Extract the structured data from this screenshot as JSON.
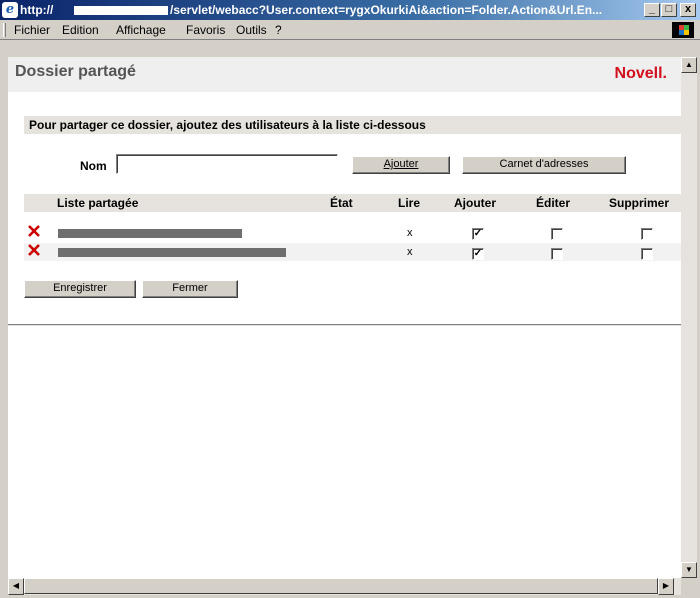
{
  "window": {
    "title_prefix": "http://",
    "title_suffix": "/servlet/webacc?User.context=rygxOkurkiAi&action=Folder.Action&Url.En...",
    "buttons": [
      "_",
      "□",
      "x"
    ]
  },
  "menu": [
    "Fichier",
    "Edition",
    "Affichage",
    "Favoris",
    "Outils",
    "?"
  ],
  "header": {
    "title": "Dossier partagé",
    "brand": "Novell."
  },
  "instructions": "Pour partager ce dossier, ajoutez des utilisateurs à la liste ci-dessous",
  "form": {
    "nom_label": "Nom",
    "nom_value": "",
    "ajouter_button": "Ajouter",
    "carnet_button": "Carnet d'adresses"
  },
  "table": {
    "headers": {
      "liste": "Liste partagée",
      "etat": "État",
      "lire": "Lire",
      "ajouter": "Ajouter",
      "editer": "Éditer",
      "supprimer": "Supprimer"
    },
    "rows": [
      {
        "lire": "x",
        "ajouter": true,
        "editer": false,
        "supprimer": false,
        "check_mark": "✓"
      },
      {
        "lire": "x",
        "ajouter": true,
        "editer": false,
        "supprimer": false,
        "check_mark": "✓"
      }
    ]
  },
  "actions": {
    "enregistrer": "Enregistrer",
    "fermer": "Fermer"
  },
  "icons": {
    "delete": "red-x-icon",
    "browser": "ie-icon",
    "throbber": "windows-logo-icon"
  },
  "colors": {
    "brand": "#d20f1e",
    "titlebar": "#0a246a",
    "delete": "#cc0000"
  }
}
